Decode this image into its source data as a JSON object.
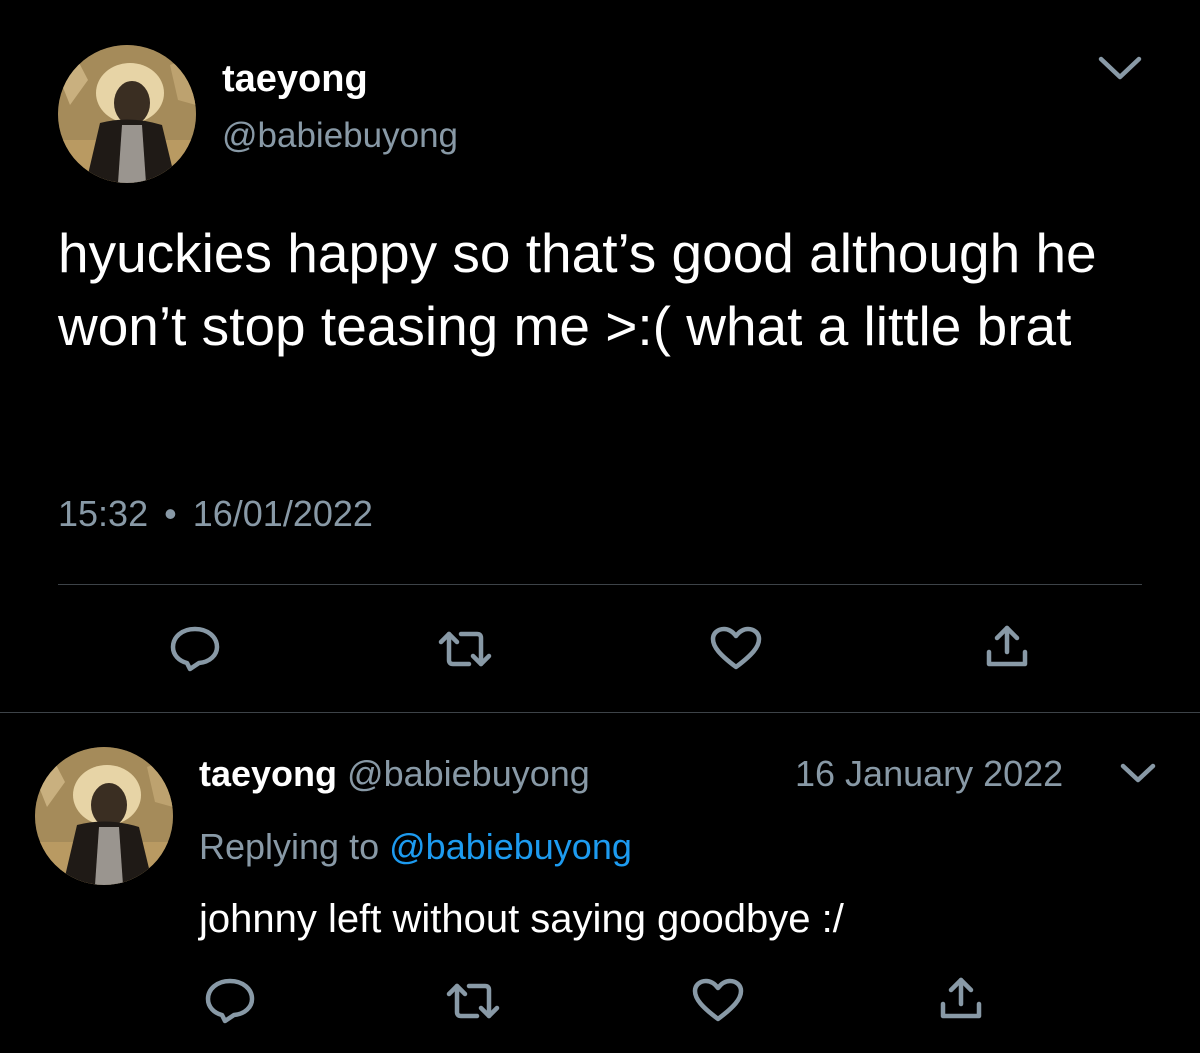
{
  "main_tweet": {
    "display_name": "taeyong",
    "handle": "@babiebuyong",
    "text": "hyuckies happy so that’s good although he won’t stop teasing me >:( what a little brat",
    "time": "15:32",
    "separator": "•",
    "date": "16/01/2022",
    "menu_icon": "chevron-down-icon",
    "actions": [
      "reply-icon",
      "retweet-icon",
      "like-icon",
      "share-icon"
    ]
  },
  "reply_tweet": {
    "display_name": "taeyong",
    "handle": "@babiebuyong",
    "date": "16 January 2022",
    "replying_prefix": "Replying to",
    "replying_handle": "@babiebuyong",
    "text": "johnny left without saying goodbye :/",
    "menu_icon": "chevron-down-icon",
    "actions": [
      "reply-icon",
      "retweet-icon",
      "like-icon",
      "share-icon"
    ]
  },
  "colors": {
    "background": "#000000",
    "text": "#ffffff",
    "secondary": "#8899a6",
    "link": "#1d9bf0",
    "divider": "#3d4348"
  }
}
